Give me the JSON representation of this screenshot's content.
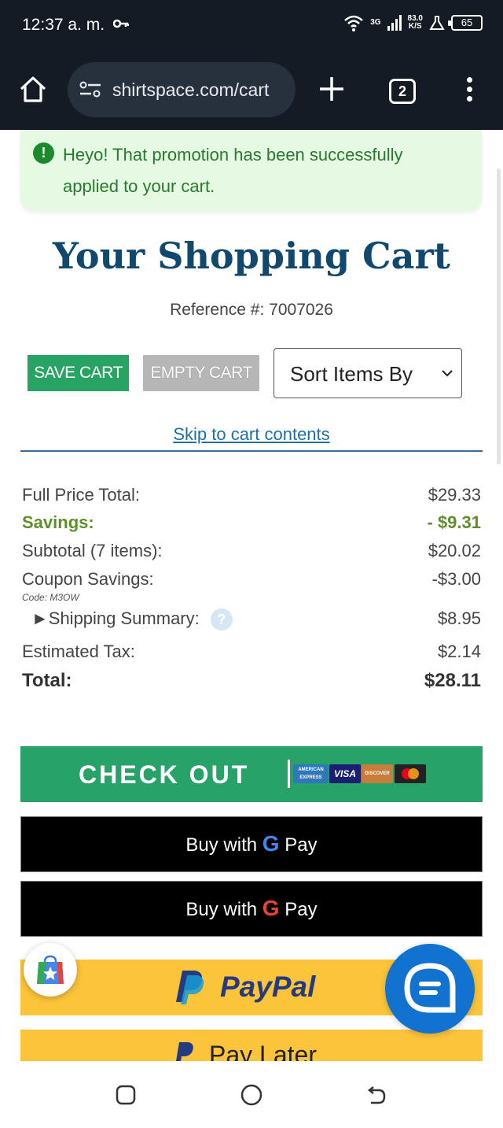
{
  "status_bar": {
    "time": "12:37 a. m.",
    "network": "3G",
    "speed_value": "83.0",
    "speed_unit": "K/S",
    "battery": "65"
  },
  "browser": {
    "url": "shirtspace.com/cart",
    "tab_count": "2"
  },
  "alert": {
    "message": "Heyo! That promotion has been successfully applied to your cart."
  },
  "page": {
    "title": "Your Shopping Cart",
    "reference": "Reference #: 7007026"
  },
  "actions": {
    "save_cart": "SAVE CART",
    "empty_cart": "EMPTY CART",
    "sort_label": "Sort Items By",
    "skip_link": "Skip to cart contents"
  },
  "summary": {
    "full_price_label": "Full Price Total:",
    "full_price_value": "$29.33",
    "savings_label": "Savings:",
    "savings_value": "- $9.31",
    "subtotal_label": "Subtotal (7 items):",
    "subtotal_value": "$20.02",
    "coupon_label": "Coupon Savings:",
    "coupon_value": "-$3.00",
    "coupon_code": "Code: M3OW",
    "shipping_label": "►Shipping Summary:",
    "shipping_value": "$8.95",
    "help_glyph": "?",
    "tax_label": "Estimated Tax:",
    "tax_value": "$2.14",
    "total_label": "Total:",
    "total_value": "$28.11"
  },
  "payment": {
    "checkout_label": "CHECK OUT",
    "card_amex": "AMERICAN EXPRESS",
    "card_visa": "VISA",
    "card_discover": "DISCOVER",
    "gpay_prefix": "Buy with",
    "gpay_g": "G",
    "gpay_pay": "Pay",
    "paypal_label": "PayPal",
    "paylater_label": "Pay Later"
  },
  "colors": {
    "brand_blue": "#10486e",
    "checkout_green": "#27a36a",
    "paypal_yellow": "#fcc43a",
    "chat_blue": "#1272cf"
  }
}
